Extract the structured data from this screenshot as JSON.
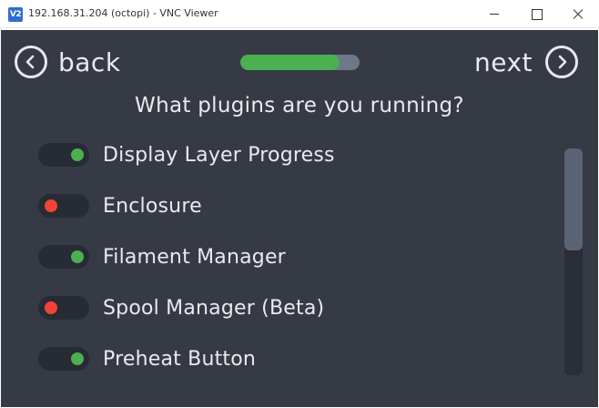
{
  "window": {
    "title": "192.168.31.204 (octopi) - VNC Viewer",
    "icon": "vnc-logo-icon",
    "icon_text": "V2"
  },
  "nav": {
    "back_label": "back",
    "next_label": "next",
    "back_icon": "chevron-left-circle-icon",
    "next_icon": "chevron-right-circle-icon"
  },
  "progress": {
    "fraction": 0.83,
    "color": "#4caf50"
  },
  "question": "What plugins are you running?",
  "plugins": [
    {
      "label": "Display Layer Progress",
      "enabled": true
    },
    {
      "label": "Enclosure",
      "enabled": false
    },
    {
      "label": "Filament Manager",
      "enabled": true
    },
    {
      "label": "Spool Manager (Beta)",
      "enabled": false
    },
    {
      "label": "Preheat Button",
      "enabled": true
    }
  ],
  "colors": {
    "background": "#353a45",
    "toggle_on": "#4caf50",
    "toggle_off": "#f44336",
    "text": "#e9eaec"
  },
  "scrollbar": {
    "position": 0.0,
    "visible_fraction": 0.45
  }
}
